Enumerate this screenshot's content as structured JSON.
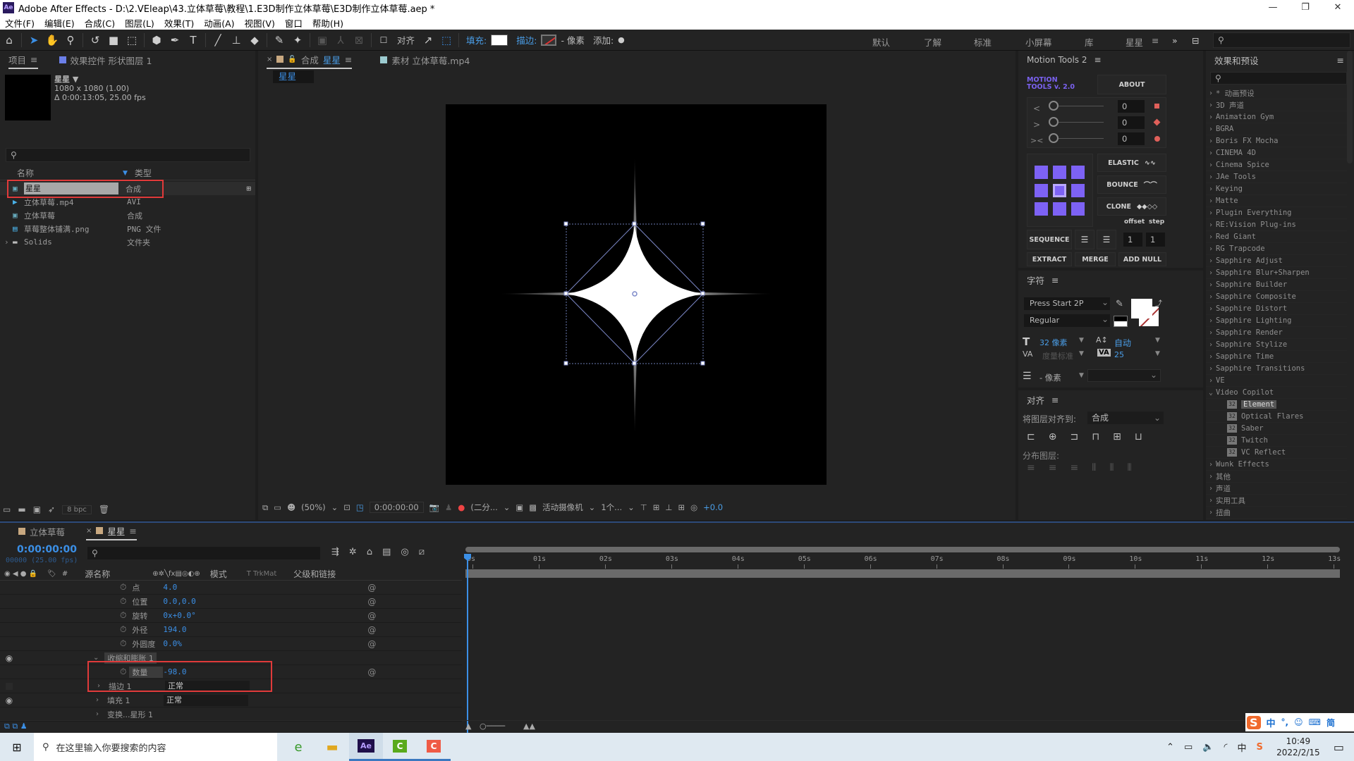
{
  "window": {
    "app_icon": "Ae",
    "title": "Adobe After Effects - D:\\2.VEleap\\43.立体草莓\\教程\\1.E3D制作立体草莓\\E3D制作立体草莓.aep *",
    "controls": {
      "minimize": "—",
      "restore": "❐",
      "close": "✕"
    }
  },
  "menu": [
    "文件(F)",
    "编辑(E)",
    "合成(C)",
    "图层(L)",
    "效果(T)",
    "动画(A)",
    "视图(V)",
    "窗口",
    "帮助(H)"
  ],
  "toolbar": {
    "align_label": "对齐",
    "fill_label": "填充:",
    "stroke_label": "描边:",
    "stroke_width": "- 像素",
    "add_label": "添加:",
    "workspaces": [
      "默认",
      "了解",
      "标准",
      "小屏幕",
      "库"
    ],
    "active_workspace": "星星",
    "fill_color": "#ffffff",
    "accent": "#3b8fe6"
  },
  "project": {
    "tab_label": "项目",
    "effects_tab_label": "效果控件 形状图层 1",
    "selected_name": "星星 ▼",
    "selected_info": [
      "1080 x 1080 (1.00)",
      "Δ 0:00:13:05, 25.00 fps"
    ],
    "search_placeholder": "",
    "col_name": "名称",
    "col_type": "类型",
    "items": [
      {
        "name": "星星",
        "type": "合成",
        "icon": "composition-icon",
        "selected": true
      },
      {
        "name": "立体草莓.mp4",
        "type": "AVI",
        "icon": "video-file-icon"
      },
      {
        "name": "立体草莓",
        "type": "合成",
        "icon": "composition-icon"
      },
      {
        "name": "草莓整体铺满.png",
        "type": "PNG 文件",
        "icon": "image-file-icon"
      },
      {
        "name": "Solids",
        "type": "文件夹",
        "icon": "folder-icon"
      }
    ],
    "bpc": "8 bpc"
  },
  "composition": {
    "tab_prefix": "合成",
    "tab_name": "星星",
    "footage_tab": "素材 立体草莓.mp4",
    "breadcrumb": "星星",
    "zoom": "(50%)",
    "timecode": "0:00:00:00",
    "resolution": "(二分...",
    "camera": "活动摄像机",
    "views": "1个...",
    "exposure": "+0.0"
  },
  "motion_tools": {
    "title": "Motion Tools 2",
    "logo": [
      "MOTION",
      "TOOLS v. 2.0"
    ],
    "about": "ABOUT",
    "sliders": [
      {
        "icon": "<",
        "value": "0"
      },
      {
        "icon": ">",
        "value": "0"
      },
      {
        "icon": "><",
        "value": "0"
      }
    ],
    "elastic": "ELASTIC",
    "bounce": "BOUNCE",
    "clone": "CLONE",
    "offset_label": "offset",
    "step_label": "step",
    "sequence": "SEQUENCE",
    "offset_value": "1",
    "step_value": "1",
    "extract": "EXTRACT",
    "merge": "MERGE",
    "add_null": "ADD NULL"
  },
  "character": {
    "title": "字符",
    "font": "Press Start 2P",
    "style": "Regular",
    "size": "32 像素",
    "leading": "自动",
    "kerning": "度量标准",
    "tracking": "25",
    "stroke": "- 像素"
  },
  "align": {
    "title": "对齐",
    "align_to_label": "将图层对齐到:",
    "align_to_value": "合成",
    "distribute_label": "分布图层:"
  },
  "effects": {
    "title": "效果和预设",
    "items": [
      {
        "label": "* 动画预设",
        "type": "group"
      },
      {
        "label": "3D 声道",
        "type": "group"
      },
      {
        "label": "Animation Gym",
        "type": "group"
      },
      {
        "label": "BGRA",
        "type": "group"
      },
      {
        "label": "Boris FX Mocha",
        "type": "group"
      },
      {
        "label": "CINEMA 4D",
        "type": "group"
      },
      {
        "label": "Cinema Spice",
        "type": "group"
      },
      {
        "label": "JAe Tools",
        "type": "group"
      },
      {
        "label": "Keying",
        "type": "group"
      },
      {
        "label": "Matte",
        "type": "group"
      },
      {
        "label": "Plugin Everything",
        "type": "group"
      },
      {
        "label": "RE:Vision Plug-ins",
        "type": "group"
      },
      {
        "label": "Red Giant",
        "type": "group"
      },
      {
        "label": "RG Trapcode",
        "type": "group"
      },
      {
        "label": "Sapphire Adjust",
        "type": "group"
      },
      {
        "label": "Sapphire Blur+Sharpen",
        "type": "group"
      },
      {
        "label": "Sapphire Builder",
        "type": "group"
      },
      {
        "label": "Sapphire Composite",
        "type": "group"
      },
      {
        "label": "Sapphire Distort",
        "type": "group"
      },
      {
        "label": "Sapphire Lighting",
        "type": "group"
      },
      {
        "label": "Sapphire Render",
        "type": "group"
      },
      {
        "label": "Sapphire Stylize",
        "type": "group"
      },
      {
        "label": "Sapphire Time",
        "type": "group"
      },
      {
        "label": "Sapphire Transitions",
        "type": "group"
      },
      {
        "label": "VE",
        "type": "group"
      },
      {
        "label": "Video Copilot",
        "type": "open"
      },
      {
        "label": "Element",
        "type": "effect",
        "selected": true
      },
      {
        "label": "Optical Flares",
        "type": "effect"
      },
      {
        "label": "Saber",
        "type": "effect"
      },
      {
        "label": "Twitch",
        "type": "effect"
      },
      {
        "label": "VC Reflect",
        "type": "effect"
      },
      {
        "label": "Wunk Effects",
        "type": "group"
      },
      {
        "label": "其他",
        "type": "group"
      },
      {
        "label": "声道",
        "type": "group"
      },
      {
        "label": "实用工具",
        "type": "group"
      },
      {
        "label": "扭曲",
        "type": "group"
      }
    ]
  },
  "timeline": {
    "tabs": [
      {
        "label": "立体草莓"
      },
      {
        "label": "星星",
        "active": true
      }
    ],
    "timecode": "0:00:00:00",
    "frame_info": "00000 (25.00 fps)",
    "columns": {
      "source_name": "源名称",
      "mode": "模式",
      "trkmat": "T  TrkMat",
      "parent": "父级和链接"
    },
    "properties": [
      {
        "name": "点",
        "value": "4.0"
      },
      {
        "name": "位置",
        "value": "0.0,0.0"
      },
      {
        "name": "旋转",
        "value": "0x+0.0°"
      },
      {
        "name": "外径",
        "value": "194.0"
      },
      {
        "name": "外圆度",
        "value": "0.0%"
      }
    ],
    "effect_group": "收缩和膨胀 1",
    "effect_prop": {
      "name": "数量",
      "value": "-98.0"
    },
    "groups": [
      {
        "name": "描边 1",
        "mode": "正常"
      },
      {
        "name": "填充 1",
        "mode": "正常"
      },
      {
        "name": "变换...星形 1",
        "mode": ""
      }
    ],
    "ruler": [
      "0s",
      "01s",
      "02s",
      "03s",
      "04s",
      "05s",
      "06s",
      "07s",
      "08s",
      "09s",
      "10s",
      "11s",
      "12s",
      "13s"
    ]
  },
  "taskbar": {
    "search_placeholder": "在这里输入你要搜索的内容",
    "time": "10:49",
    "date": "2022/2/15",
    "ime": [
      "中",
      "°,",
      "☺",
      "⌨",
      "简"
    ],
    "tray_lang": "中"
  }
}
